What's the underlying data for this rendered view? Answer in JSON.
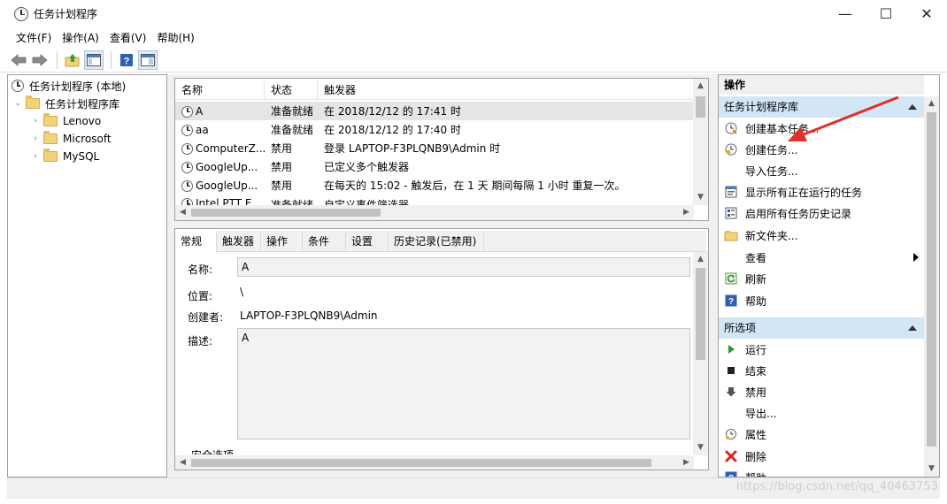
{
  "window": {
    "title": "任务计划程序",
    "minimize_glyph": "—",
    "maximize_glyph": "☐",
    "close_glyph": "✕"
  },
  "menu": [
    "文件(F)",
    "操作(A)",
    "查看(V)",
    "帮助(H)"
  ],
  "toolbar": {
    "icons": [
      "back-arrow-icon",
      "forward-arrow-icon",
      "up-folder-icon",
      "show-hide-pane-icon",
      "help-icon",
      "properties-pane-icon"
    ]
  },
  "tree": {
    "root": "任务计划程序 (本地)",
    "library": "任务计划程序库",
    "folders": [
      "Lenovo",
      "Microsoft",
      "MySQL"
    ]
  },
  "tasks": {
    "columns": [
      "名称",
      "状态",
      "触发器"
    ],
    "rows": [
      {
        "name": "A",
        "status": "准备就绪",
        "trigger": "在 2018/12/12 的 17:41 时"
      },
      {
        "name": "aa",
        "status": "准备就绪",
        "trigger": "在 2018/12/12 的 17:40 时"
      },
      {
        "name": "ComputerZ...",
        "status": "禁用",
        "trigger": "登录 LAPTOP-F3PLQNB9\\Admin 时"
      },
      {
        "name": "GoogleUp...",
        "status": "禁用",
        "trigger": "已定义多个触发器"
      },
      {
        "name": "GoogleUp...",
        "status": "禁用",
        "trigger": "在每天的 15:02 - 触发后，在 1 天 期间每隔 1 小时 重复一次。"
      },
      {
        "name": "Intel PTT E...",
        "status": "准备就绪",
        "trigger": "自定义事件筛选器"
      }
    ]
  },
  "detail": {
    "tabs": [
      "常规",
      "触发器",
      "操作",
      "条件",
      "设置",
      "历史记录(已禁用)"
    ],
    "name_label": "名称:",
    "name_value": "A",
    "location_label": "位置:",
    "location_value": "\\",
    "author_label": "创建者:",
    "author_value": "LAPTOP-F3PLQNB9\\Admin",
    "desc_label": "描述:",
    "desc_value": "A",
    "security_label": "安全选项"
  },
  "actions": {
    "header": "操作",
    "section1": "任务计划程序库",
    "items1": [
      {
        "label": "创建基本任务...",
        "icon": "create-basic-task-icon"
      },
      {
        "label": "创建任务...",
        "icon": "create-task-icon"
      },
      {
        "label": "导入任务...",
        "icon": ""
      },
      {
        "label": "显示所有正在运行的任务",
        "icon": "running-tasks-icon"
      },
      {
        "label": "启用所有任务历史记录",
        "icon": "history-icon"
      },
      {
        "label": "新文件夹...",
        "icon": "new-folder-icon"
      },
      {
        "label": "查看",
        "icon": ""
      },
      {
        "label": "刷新",
        "icon": "refresh-icon"
      },
      {
        "label": "帮助",
        "icon": "help-icon"
      }
    ],
    "section2": "所选项",
    "items2": [
      {
        "label": "运行",
        "icon": "run-icon"
      },
      {
        "label": "结束",
        "icon": "end-icon"
      },
      {
        "label": "禁用",
        "icon": "disable-icon"
      },
      {
        "label": "导出...",
        "icon": ""
      },
      {
        "label": "属性",
        "icon": "properties-icon"
      },
      {
        "label": "删除",
        "icon": "delete-icon"
      },
      {
        "label": "帮助",
        "icon": "help-icon"
      }
    ]
  },
  "watermark": "https://blog.csdn.net/qq_40463753",
  "colors": {
    "section_bg": "#d2e6f6",
    "selected_tree": "#cce8ff",
    "annotation_arrow": "#e0302a"
  }
}
